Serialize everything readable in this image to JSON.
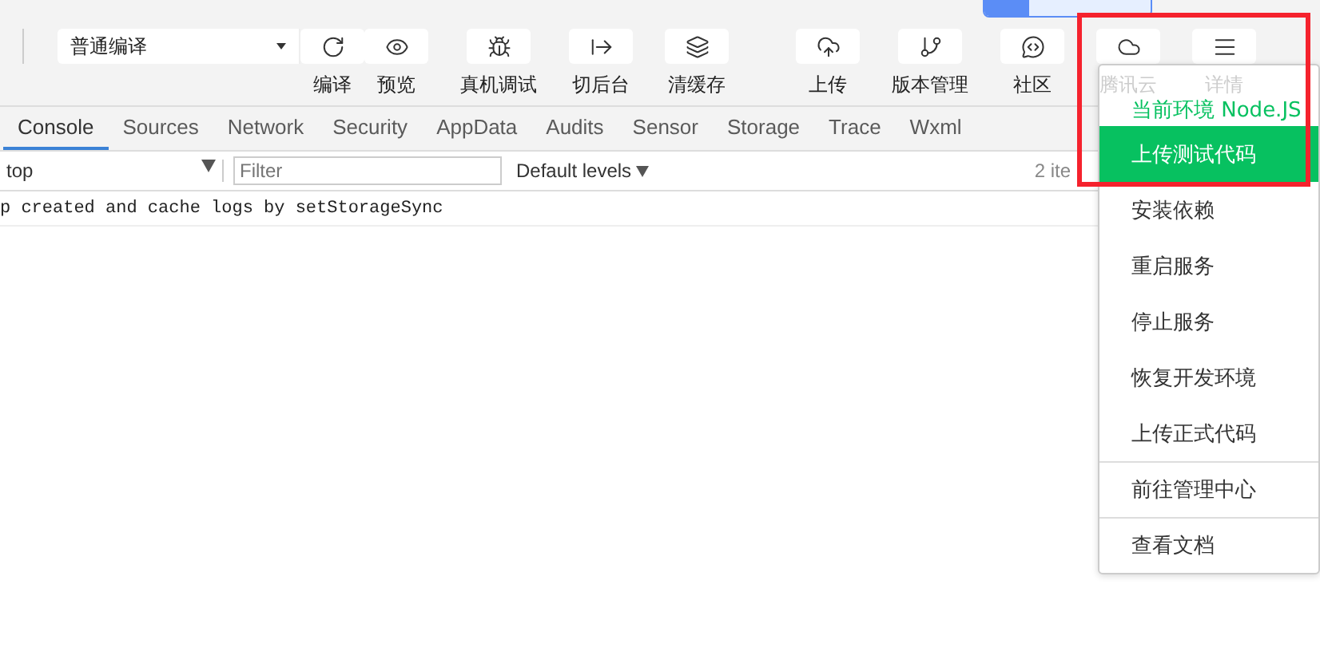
{
  "toolbar": {
    "compile_mode": "普通编译",
    "tools": [
      {
        "label": "编译",
        "faded": false
      },
      {
        "label": "预览",
        "faded": false
      },
      {
        "label": "真机调试",
        "faded": false
      },
      {
        "label": "切后台",
        "faded": false
      },
      {
        "label": "清缓存",
        "faded": false
      },
      {
        "label": "上传",
        "faded": false
      },
      {
        "label": "版本管理",
        "faded": false
      },
      {
        "label": "社区",
        "faded": false
      },
      {
        "label": "腾讯云",
        "faded": true
      },
      {
        "label": "详情",
        "faded": true
      }
    ]
  },
  "tabs": [
    {
      "label": "Console",
      "selected": true
    },
    {
      "label": "Sources",
      "selected": false
    },
    {
      "label": "Network",
      "selected": false
    },
    {
      "label": "Security",
      "selected": false
    },
    {
      "label": "AppData",
      "selected": false
    },
    {
      "label": "Audits",
      "selected": false
    },
    {
      "label": "Sensor",
      "selected": false
    },
    {
      "label": "Storage",
      "selected": false
    },
    {
      "label": "Trace",
      "selected": false
    },
    {
      "label": "Wxml",
      "selected": false
    }
  ],
  "console_bar": {
    "context": "top",
    "filter_placeholder": "Filter",
    "levels": "Default levels",
    "count": "2 ite"
  },
  "logs": [
    {
      "text": "p created and cache logs by setStorageSync"
    }
  ],
  "menu": [
    {
      "label": "当前环境 Node.JS",
      "kind": "status",
      "selected": false,
      "divider_above": false
    },
    {
      "label": "上传测试代码",
      "kind": "action",
      "selected": true,
      "divider_above": false
    },
    {
      "label": "安装依赖",
      "kind": "action",
      "selected": false,
      "divider_above": false
    },
    {
      "label": "重启服务",
      "kind": "action",
      "selected": false,
      "divider_above": false
    },
    {
      "label": "停止服务",
      "kind": "action",
      "selected": false,
      "divider_above": false
    },
    {
      "label": "恢复开发环境",
      "kind": "action",
      "selected": false,
      "divider_above": false
    },
    {
      "label": "上传正式代码",
      "kind": "action",
      "selected": false,
      "divider_above": false
    },
    {
      "label": "前往管理中心",
      "kind": "action",
      "selected": false,
      "divider_above": true
    },
    {
      "label": "查看文档",
      "kind": "action",
      "selected": false,
      "divider_above": true
    }
  ]
}
